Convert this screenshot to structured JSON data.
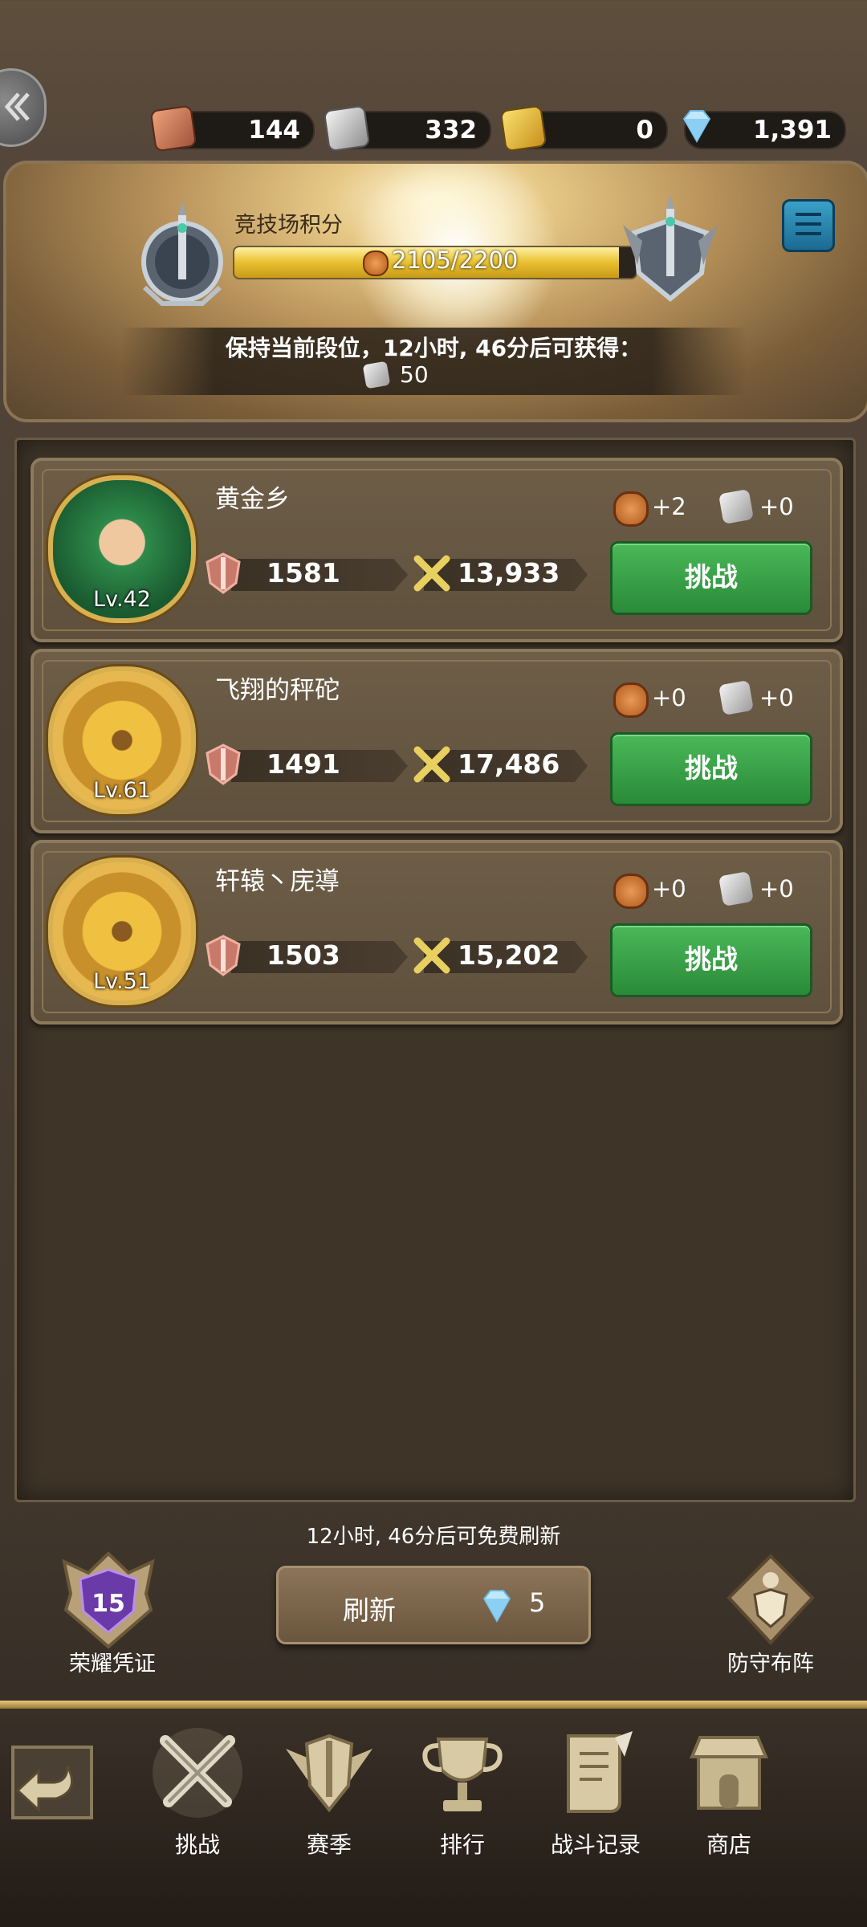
{
  "currencies": [
    {
      "name": "bronze-arena-token",
      "value": "144",
      "color": "#d4845c"
    },
    {
      "name": "silver-arena-token",
      "value": "332",
      "color": "#c8c8c8"
    },
    {
      "name": "gold-arena-token",
      "value": "0",
      "color": "#e8c040"
    },
    {
      "name": "diamond",
      "value": "1,391",
      "color": "#a8dcf8"
    }
  ],
  "arena": {
    "score_label": "竞技场积分",
    "score_current": "2105",
    "score_max": "2200",
    "score_text": "2105/2200",
    "score_progress": 0.957,
    "keep_rank_text": "保持当前段位，12小时, 46分后可获得：",
    "reward_amount": "50"
  },
  "opponents": [
    {
      "name": "黄金乡",
      "level": "Lv.42",
      "avatar": "green-hood-archer",
      "rank_points": "1581",
      "power": "13,933",
      "bronze_gain": "+2",
      "silver_gain": "+0",
      "button": "挑战"
    },
    {
      "name": "飞翔的秤砣",
      "level": "Lv.61",
      "avatar": "golden-knight",
      "rank_points": "1491",
      "power": "17,486",
      "bronze_gain": "+0",
      "silver_gain": "+0",
      "button": "挑战"
    },
    {
      "name": "轩辕丶庑導",
      "level": "Lv.51",
      "avatar": "golden-knight",
      "rank_points": "1503",
      "power": "15,202",
      "bronze_gain": "+0",
      "silver_gain": "+0",
      "button": "挑战"
    }
  ],
  "bottom": {
    "free_refresh_text": "12小时, 46分后可免费刷新",
    "honor_count": "15",
    "honor_label": "荣耀凭证",
    "refresh_label": "刷新",
    "refresh_cost": "5",
    "defense_label": "防守布阵"
  },
  "nav": {
    "tabs": [
      {
        "label": "挑战",
        "icon": "crossed-swords-icon",
        "active": true
      },
      {
        "label": "赛季",
        "icon": "winged-shield-icon",
        "active": false
      },
      {
        "label": "排行",
        "icon": "trophy-icon",
        "active": false
      },
      {
        "label": "战斗记录",
        "icon": "scroll-icon",
        "active": false
      },
      {
        "label": "商店",
        "icon": "shop-icon",
        "active": false
      }
    ]
  },
  "colors": {
    "challenge_green": "#3aa048",
    "accent_gold": "#e8c030"
  }
}
